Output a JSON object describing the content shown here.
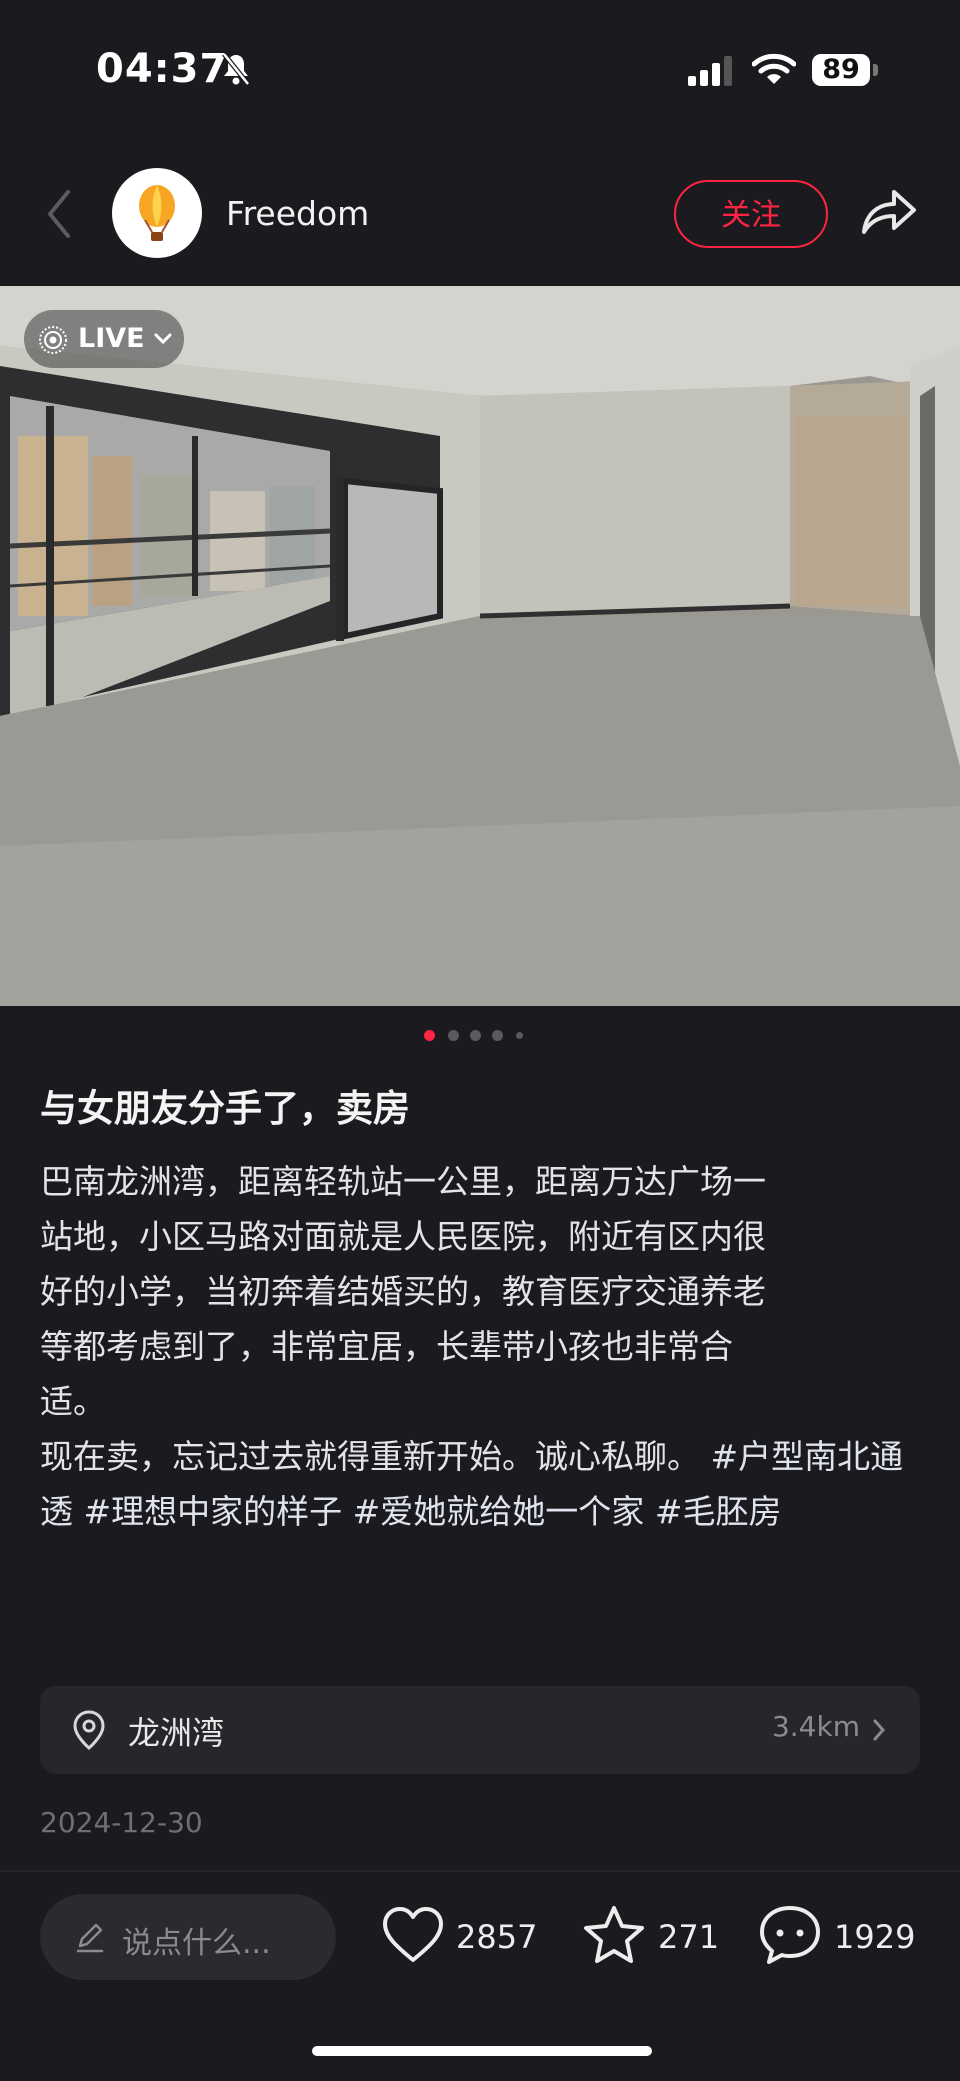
{
  "status": {
    "time": "04:37",
    "battery": "89"
  },
  "header": {
    "author": "Freedom",
    "follow_label": "关注"
  },
  "media": {
    "live_label": "LIVE",
    "page_count": 5,
    "active_index": 0
  },
  "post": {
    "title": "与女朋友分手了，卖房",
    "body_lines": [
      "巴南龙洲湾，距离轻轨站一公里，距离万达广场一",
      "站地，小区马路对面就是人民医院，附近有区内很",
      "好的小学，当初奔着结婚买的，教育医疗交通养老",
      "等都考虑到了，非常宜居，长辈带小孩也非常合",
      "适。",
      "现在卖，忘记过去就得重新开始。诚心私聊。"
    ],
    "tags": [
      "#户型南北通透",
      "#理想中家的样子",
      "#爱她就给她一个家",
      "#毛胚房"
    ],
    "date": "2024-12-30"
  },
  "location": {
    "name": "龙洲湾",
    "distance": "3.4km"
  },
  "bottom_bar": {
    "comment_placeholder": "说点什么...",
    "likes": "2857",
    "stars": "271",
    "comments": "1929"
  },
  "colors": {
    "accent": "#ff2442",
    "background": "#1b1b1f"
  }
}
